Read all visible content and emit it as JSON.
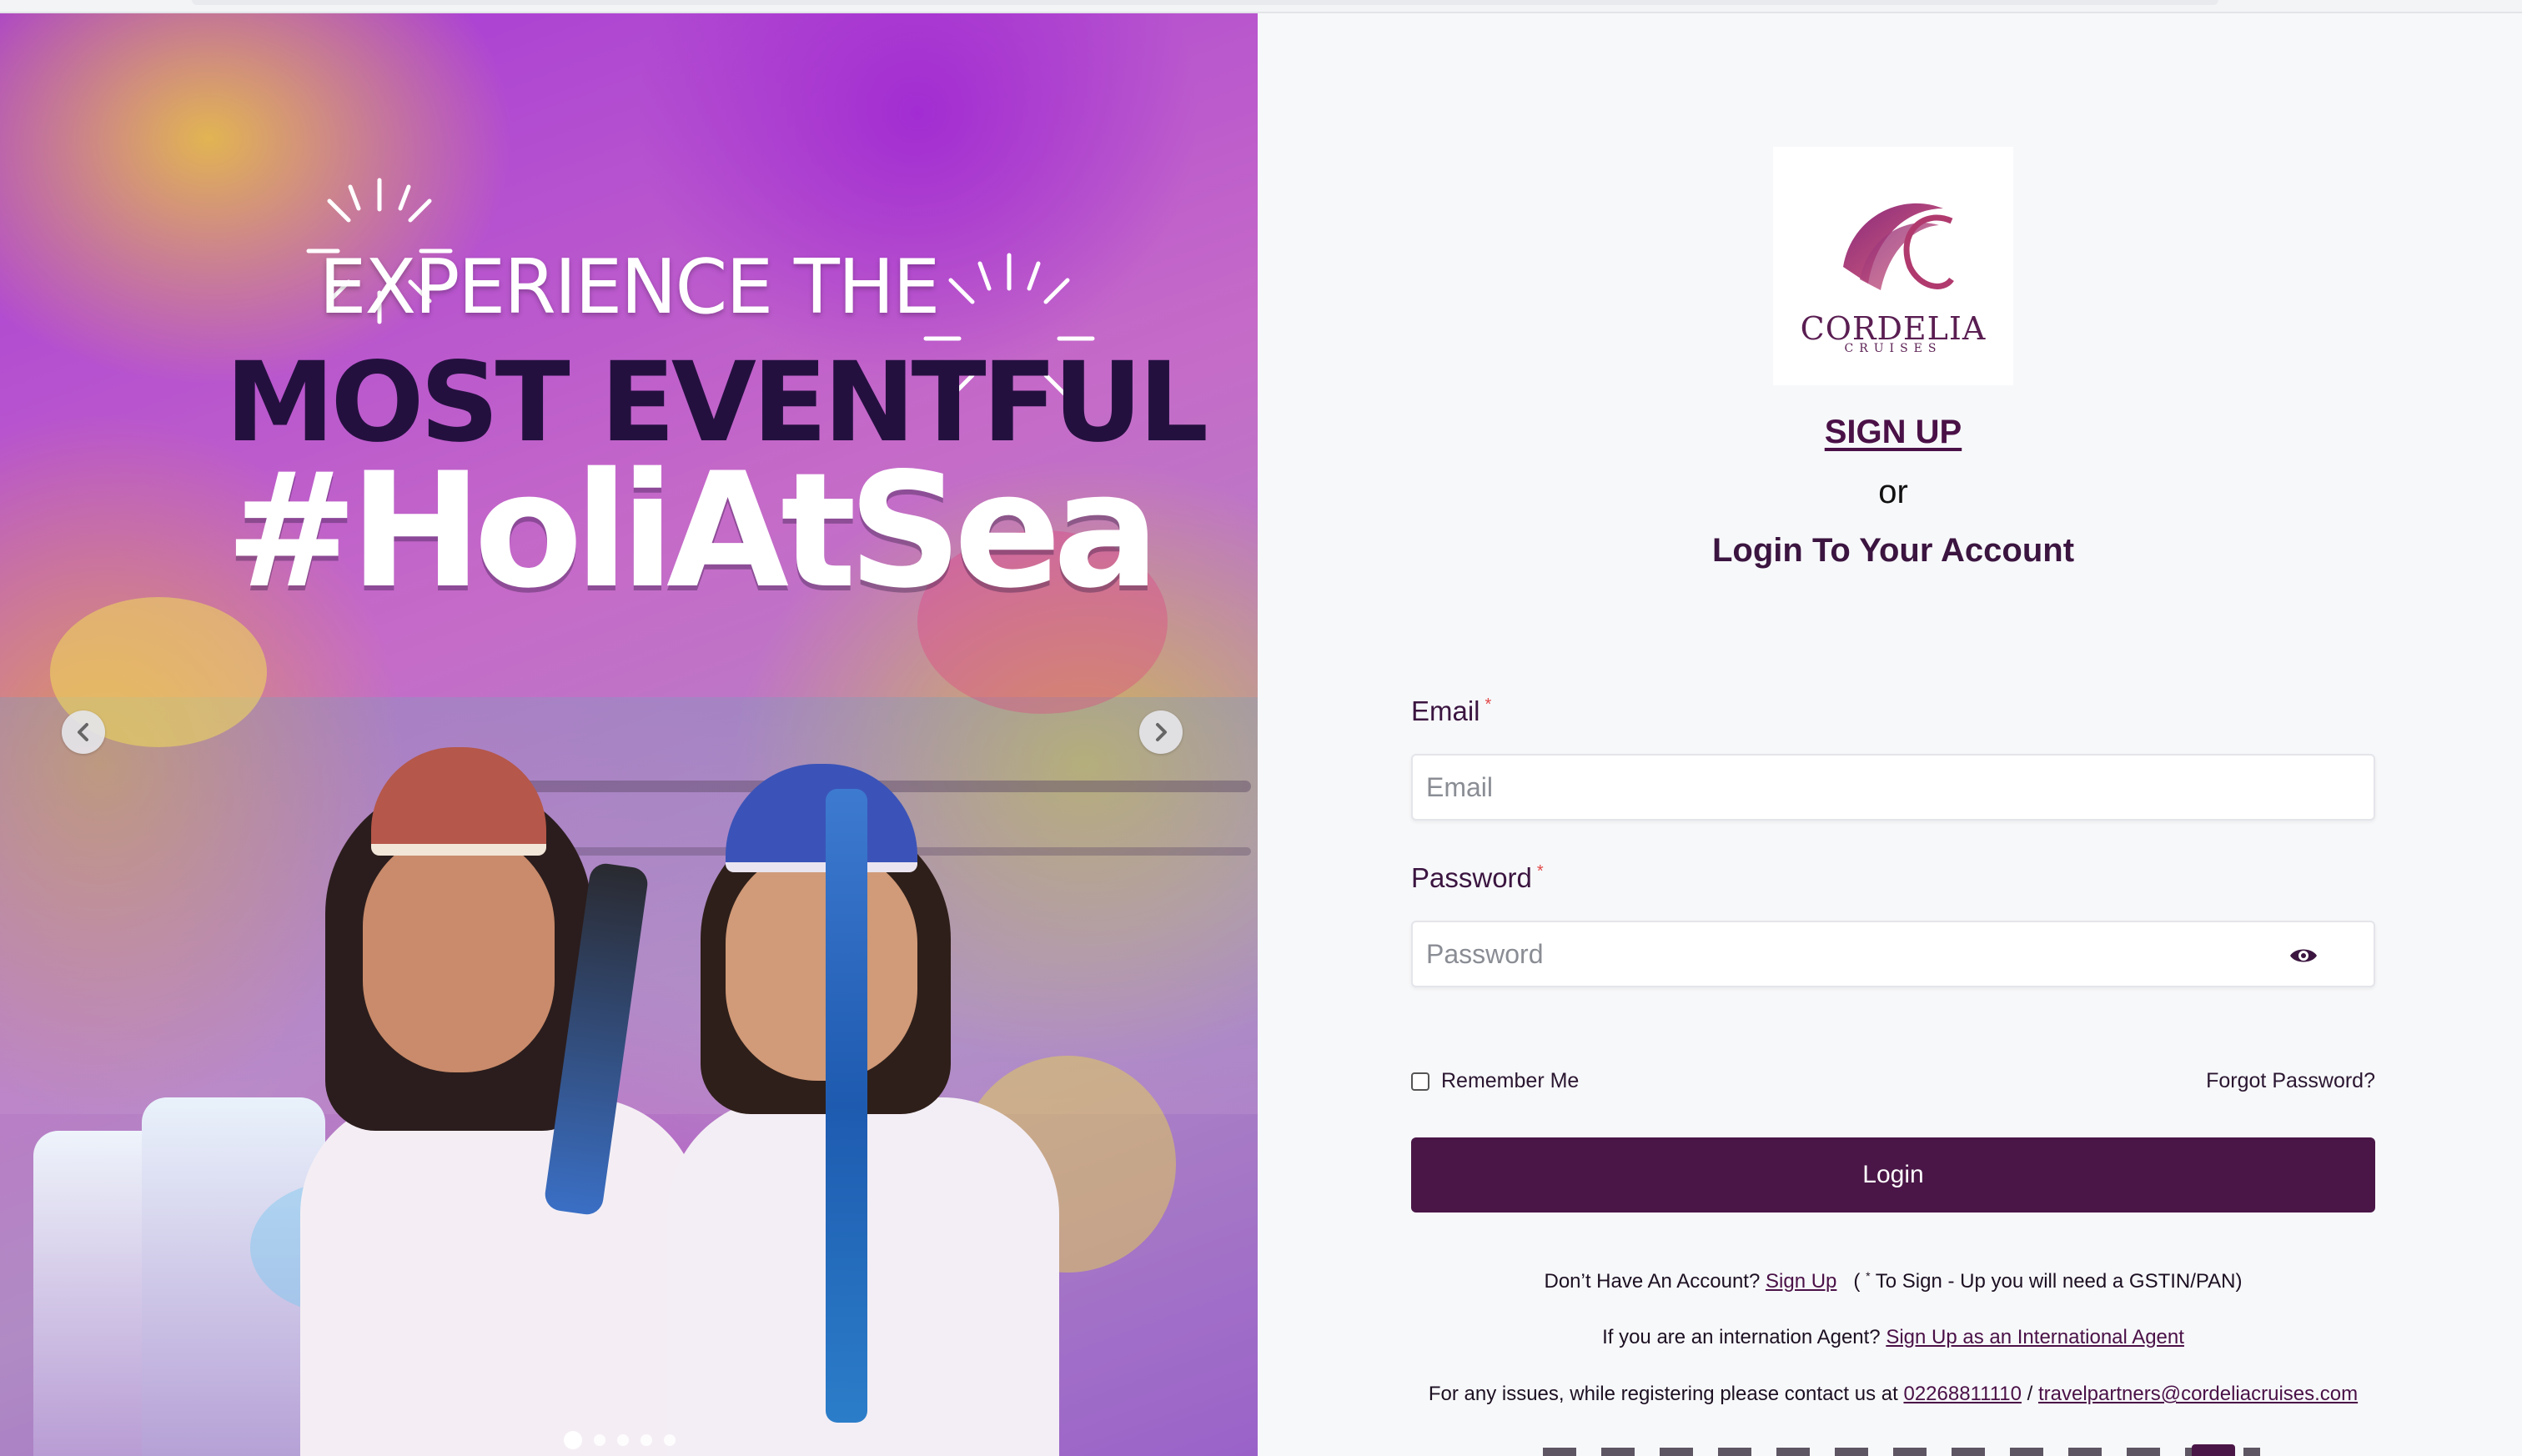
{
  "hero": {
    "headline_line1": "EXPERIENCE THE",
    "headline_line2": "MOST EVENTFUL",
    "headline_line3": "#HoliAtSea",
    "carousel": {
      "slide_count": 5,
      "active_index": 0,
      "prev_icon": "chevron-left-icon",
      "next_icon": "chevron-right-icon"
    }
  },
  "brand": {
    "name": "CORDELIA",
    "tagline": "CRUISES",
    "color": "#5a1e52"
  },
  "auth": {
    "signup_link": "SIGN UP",
    "or_text": "or",
    "title": "Login To Your Account"
  },
  "form": {
    "email": {
      "label": "Email",
      "required_mark": "*",
      "placeholder": "Email",
      "value": ""
    },
    "password": {
      "label": "Password",
      "required_mark": "*",
      "placeholder": "Password",
      "value": "",
      "toggle_icon": "eye-icon"
    },
    "remember_me": {
      "label": "Remember Me",
      "checked": false
    },
    "forgot_password": "Forgot Password?",
    "submit_label": "Login"
  },
  "footer": {
    "no_account_prefix": "Don’t Have An Account?",
    "signup_link": "Sign Up",
    "gstin_open": "(",
    "gstin_star": "*",
    "gstin_note": "To Sign - Up you will need a GSTIN/PAN)",
    "intl_prefix": "If you are an internation Agent?",
    "intl_link": "Sign Up as an International Agent",
    "contact_prefix": "For any issues, while registering please contact us at",
    "phone": "02268811110",
    "separator": "/",
    "email": "travelpartners@cordeliacruises.com"
  },
  "colors": {
    "primary": "#4a1647",
    "accent_required": "#e24848",
    "panel_bg": "#f7f8fa"
  }
}
